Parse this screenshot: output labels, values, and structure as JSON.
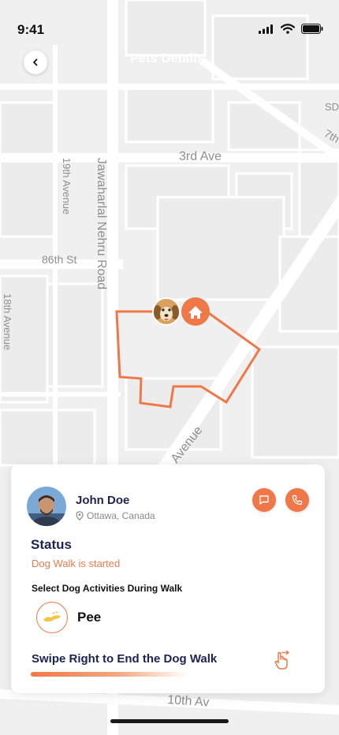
{
  "status_bar": {
    "time": "9:41"
  },
  "header": {
    "title": "Pets Details"
  },
  "map": {
    "streets": {
      "third_ave": "3rd Ave",
      "nineteenth_ave": "19th Avenue",
      "jawaharlal": "Jawaharlal Nehru Road",
      "eighty_sixth": "86th St",
      "eighteenth_ave": "18th Avenue",
      "avenue": "Avenue",
      "tenth_av": "10th Av",
      "seventh": "7th",
      "sd": "SD"
    }
  },
  "walker": {
    "name": "John Doe",
    "location": "Ottawa, Canada"
  },
  "status": {
    "title": "Status",
    "text": "Dog Walk is started"
  },
  "activities": {
    "label": "Select Dog Activities During Walk",
    "items": [
      {
        "label": "Pee"
      }
    ]
  },
  "swipe": {
    "label": "Swipe Right to End the Dog Walk"
  },
  "colors": {
    "accent": "#f07848",
    "navy": "#1d2350",
    "map_bg": "#f2f2f2",
    "road": "#ffffff"
  }
}
